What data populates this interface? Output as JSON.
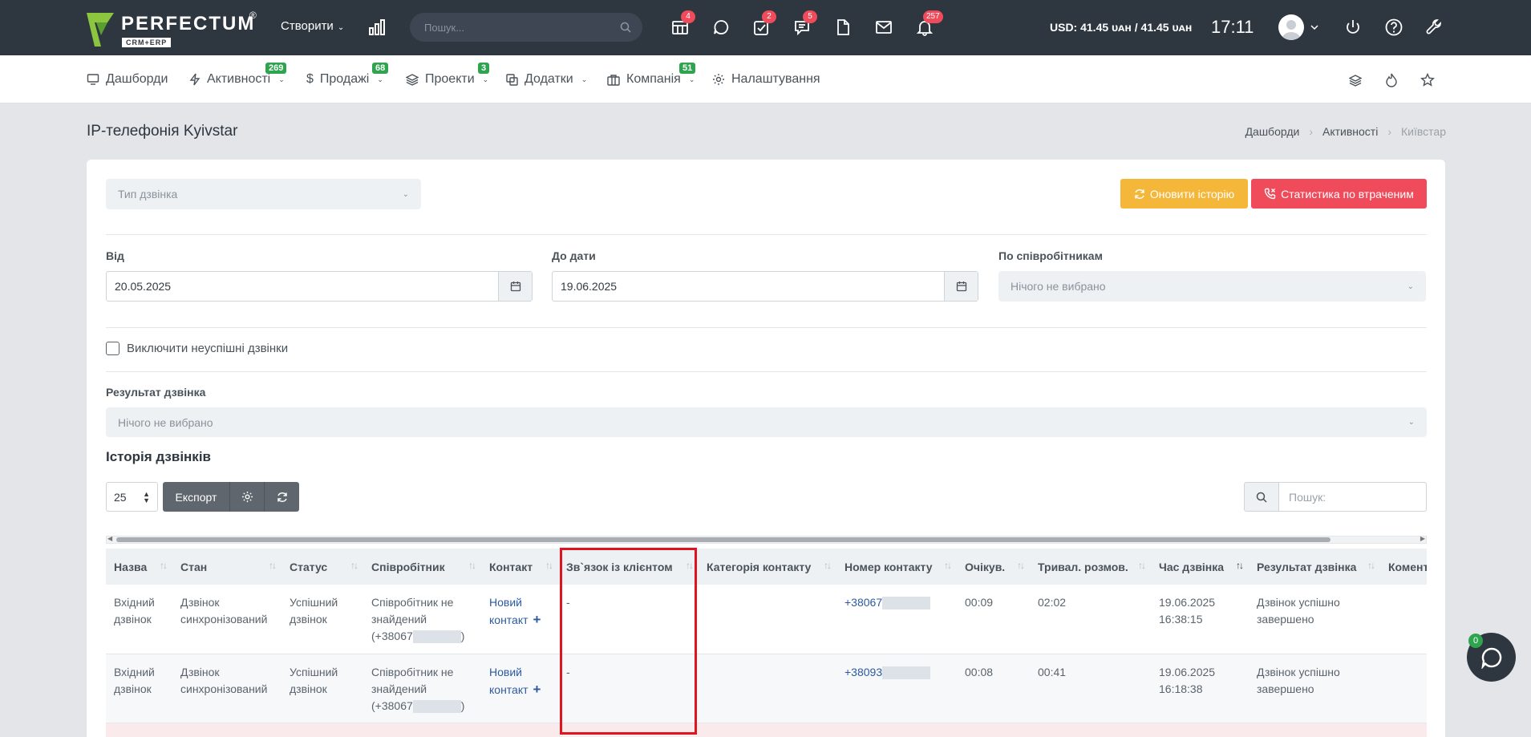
{
  "topbar": {
    "logo_text": "PERFECTUM",
    "logo_sub": "CRM+ERP",
    "logo_reg": "®",
    "create_label": "Створити",
    "search_placeholder": "Пошук...",
    "badges": {
      "calendar": "4",
      "tasks": "2",
      "messages": "5",
      "notifications": "257"
    },
    "currency": "USD: 41.45 ᴜᴀʜ / 41.45 ᴜᴀʜ",
    "time": "17:11"
  },
  "nav": {
    "items": [
      {
        "label": "Дашборди",
        "badge": ""
      },
      {
        "label": "Активності",
        "badge": "269"
      },
      {
        "label": "Продажі",
        "badge": "68"
      },
      {
        "label": "Проекти",
        "badge": "3"
      },
      {
        "label": "Додатки",
        "badge": ""
      },
      {
        "label": "Компанія",
        "badge": "51"
      },
      {
        "label": "Налаштування",
        "badge": ""
      }
    ]
  },
  "page": {
    "title": "IP-телефонія Kyivstar",
    "breadcrumb": [
      "Дашборди",
      "Активності",
      "Київстар"
    ]
  },
  "filters": {
    "call_type_placeholder": "Тип дзвінка",
    "refresh_history": "Оновити історію",
    "missed_stats": "Статистика по втраченим",
    "from_label": "Від",
    "from_value": "20.05.2025",
    "to_label": "До дати",
    "to_value": "19.06.2025",
    "employees_label": "По співробітникам",
    "employees_value": "Нічого не вибрано",
    "exclude_failed": "Виключити неуспішні дзвінки",
    "result_label": "Результат дзвінка",
    "result_value": "Нічого не вибрано"
  },
  "history": {
    "title": "Історія дзвінків",
    "per_page": "25",
    "export_label": "Експорт",
    "search_placeholder": "Пошук:",
    "columns": [
      "Назва",
      "Стан",
      "Статус",
      "Співробітник",
      "Контакт",
      "Зв`язок із клієнтом",
      "Категорія контакту",
      "Номер контакту",
      "Очікув.",
      "Тривал. розмов.",
      "Час дзвінка",
      "Результат дзвінка",
      "Комент"
    ],
    "rows": [
      {
        "name": "Вхідний дзвінок",
        "state": "Дзвінок синхронізований",
        "status": "Успішний дзвінок",
        "employee": "Співробітник не знайдений",
        "employee_phone": "(+38067",
        "contact": "Новий контакт",
        "client_link": "-",
        "category": "",
        "phone": "+38067",
        "wait": "00:09",
        "duration": "02:02",
        "date": "19.06.2025",
        "time": "16:38:15",
        "result": "Дзвінок успішно завершено",
        "comment": ""
      },
      {
        "name": "Вхідний дзвінок",
        "state": "Дзвінок синхронізований",
        "status": "Успішний дзвінок",
        "employee": "Співробітник не знайдений",
        "employee_phone": "(+38067",
        "contact": "Новий контакт",
        "client_link": "-",
        "category": "",
        "phone": "+38093",
        "wait": "00:08",
        "duration": "00:41",
        "date": "19.06.2025",
        "time": "16:18:38",
        "result": "Дзвінок успішно завершено",
        "comment": ""
      }
    ]
  },
  "chat": {
    "badge": "0"
  },
  "colors": {
    "topbar": "#2e3640",
    "accent_yellow": "#f5b73a",
    "accent_red": "#ef4b5b",
    "badge_green": "#2ea44f",
    "highlight": "#e0141e"
  }
}
